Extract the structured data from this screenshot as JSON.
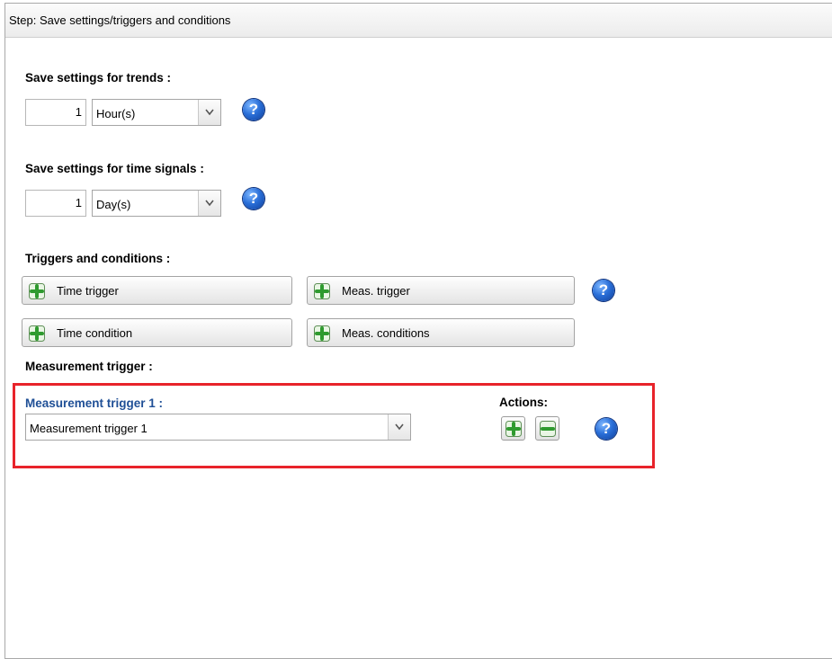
{
  "panel": {
    "title": "Step: Save settings/triggers and conditions"
  },
  "trends": {
    "label": "Save settings for trends :",
    "value": "1",
    "unit": "Hour(s)"
  },
  "time_signals": {
    "label": "Save settings for time signals :",
    "value": "1",
    "unit": "Day(s)"
  },
  "triggers": {
    "label": "Triggers and conditions :",
    "buttons": {
      "time_trigger": "Time trigger",
      "meas_trigger": "Meas. trigger",
      "time_condition": "Time condition",
      "meas_conditions": "Meas. conditions"
    }
  },
  "measurement": {
    "section_label": "Measurement trigger :",
    "item_title": "Measurement trigger 1 :",
    "selected": "Measurement trigger 1",
    "actions_label": "Actions:"
  },
  "icons": {
    "help": "question-mark-icon",
    "add": "plus-icon",
    "remove": "minus-icon",
    "dropdown": "chevron-down-icon"
  },
  "colors": {
    "highlight": "#e8232a",
    "trigger_title": "#1f4f96",
    "help_blue": "#2a6fd8",
    "plus_green": "#3aa53a"
  }
}
